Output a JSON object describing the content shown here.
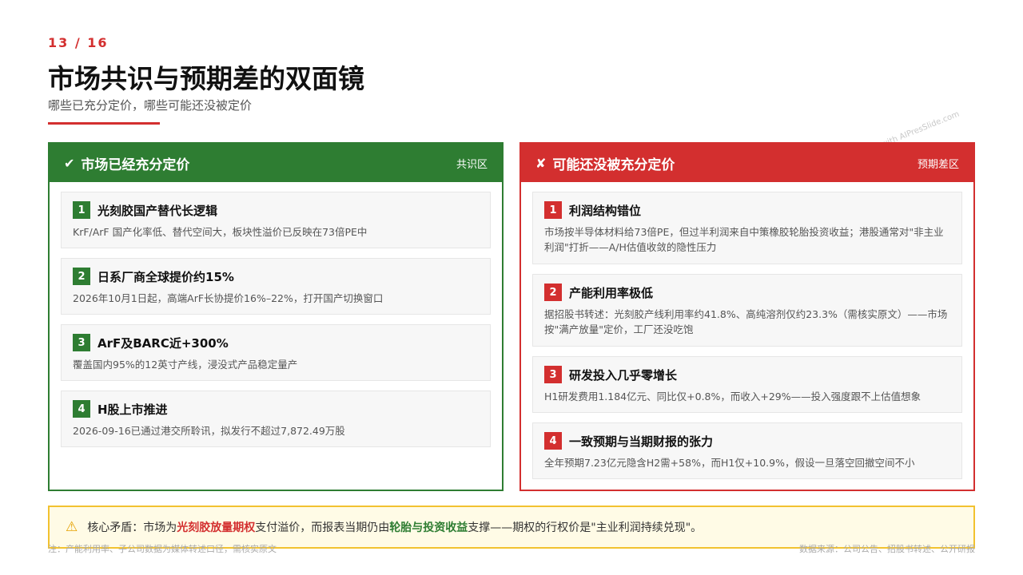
{
  "header": {
    "page_number": "13 / 16",
    "title": "市场共识与预期差的双面镜",
    "subtitle": "哪些已充分定价，哪些可能还没被定价"
  },
  "watermark": "Export with AIPresSlide.com",
  "left_panel": {
    "icon": "check-icon",
    "title": "市场已经充分定价",
    "tag": "共识区",
    "accent_color": "#2e7d32",
    "items": [
      {
        "num": "1",
        "title": "光刻胶国产替代长逻辑",
        "desc": "KrF/ArF 国产化率低、替代空间大，板块性溢价已反映在73倍PE中"
      },
      {
        "num": "2",
        "title": "日系厂商全球提价约15%",
        "desc": "2026年10月1日起，高端ArF长协提价16%–22%，打开国产切换窗口"
      },
      {
        "num": "3",
        "title": "ArF及BARC近+300%",
        "desc": "覆盖国内95%的12英寸产线，浸没式产品稳定量产"
      },
      {
        "num": "4",
        "title": "H股上市推进",
        "desc": "2026-09-16已通过港交所聆讯，拟发行不超过7,872.49万股"
      }
    ]
  },
  "right_panel": {
    "icon": "cross-icon",
    "title": "可能还没被充分定价",
    "tag": "预期差区",
    "accent_color": "#d32f2f",
    "items": [
      {
        "num": "1",
        "title": "利润结构错位",
        "desc": "市场按半导体材料给73倍PE，但过半利润来自中策橡胶轮胎投资收益；港股通常对\"非主业利润\"打折——A/H估值收敛的隐性压力"
      },
      {
        "num": "2",
        "title": "产能利用率极低",
        "desc": "据招股书转述：光刻胶产线利用率约41.8%、高纯溶剂仅约23.3%（需核实原文）——市场按\"满产放量\"定价，工厂还没吃饱"
      },
      {
        "num": "3",
        "title": "研发投入几乎零增长",
        "desc": "H1研发费用1.184亿元、同比仅+0.8%，而收入+29%——投入强度跟不上估值想象"
      },
      {
        "num": "4",
        "title": "一致预期与当期财报的张力",
        "desc": "全年预期7.23亿元隐含H2需+58%，而H1仅+10.9%，假设一旦落空回撤空间不小"
      }
    ]
  },
  "callout": {
    "icon": "warning-icon",
    "prefix": "核心矛盾：市场为",
    "highlight1": "光刻胶放量期权",
    "mid": "支付溢价，而报表当期仍由",
    "highlight2": "轮胎与投资收益",
    "suffix": "支撑——期权的行权价是\"主业利润持续兑现\"。"
  },
  "footer": {
    "note": "注：产能利用率、子公司数据为媒体转述口径，需核实原文",
    "source": "数据来源：公司公告、招股书转述、公开研报"
  }
}
